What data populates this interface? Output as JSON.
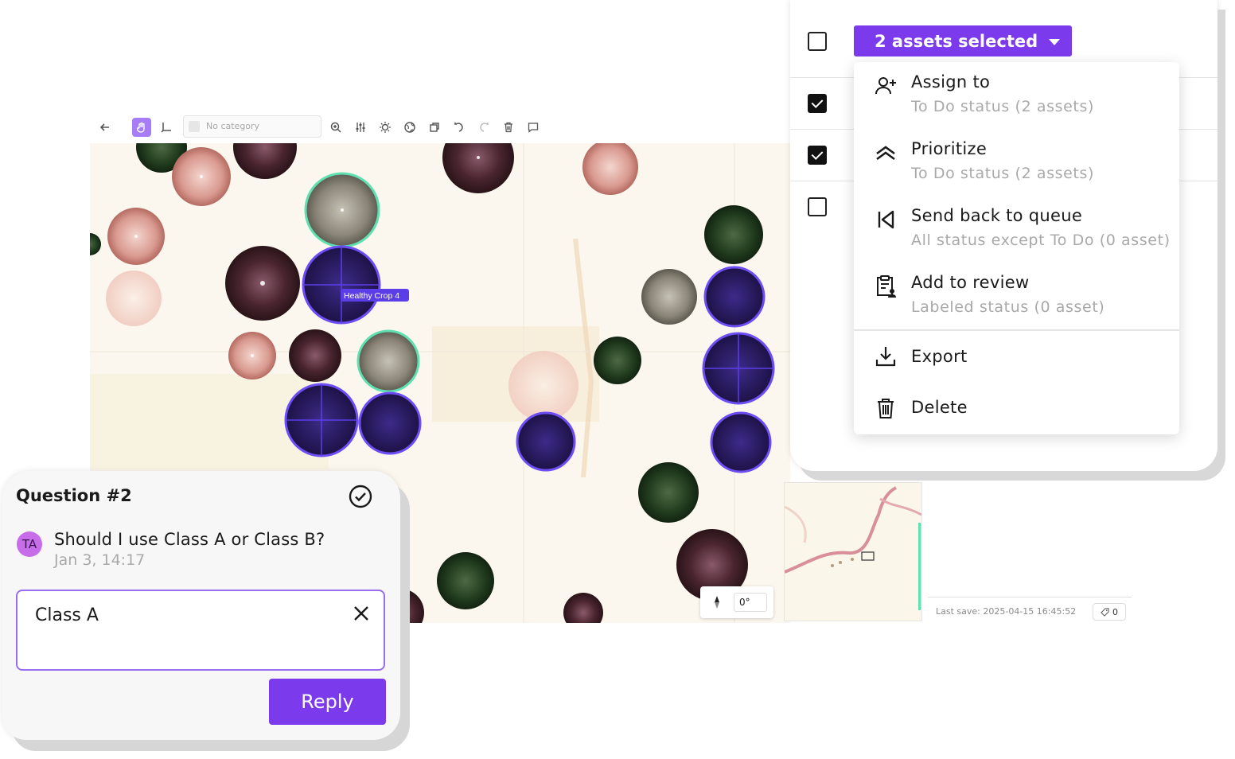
{
  "toolbar": {
    "category_placeholder": "No category",
    "icons": [
      "back-arrow-icon",
      "hand-icon",
      "bbox-tool-icon",
      "zoom-in-icon",
      "adjust-icon",
      "brightness-icon",
      "globe-icon",
      "crop-icon",
      "undo-icon",
      "redo-icon",
      "delete-icon",
      "comment-icon"
    ]
  },
  "canvas": {
    "annotation_label": "Healthy Crop 4"
  },
  "selection": {
    "button_label": "2 assets selected",
    "rows_checked": [
      false,
      true,
      true,
      false
    ]
  },
  "menu": {
    "items": [
      {
        "label": "Assign to",
        "sub": "To Do status (2 assets)",
        "icon": "user-plus-icon"
      },
      {
        "label": "Prioritize",
        "sub": "To Do status (2 assets)",
        "icon": "double-chevron-up-icon"
      },
      {
        "label": "Send back to queue",
        "sub": "All status except To Do (0 asset)",
        "icon": "skip-back-icon"
      },
      {
        "label": "Add to review",
        "sub": "Labeled status (0 asset)",
        "icon": "clipboard-user-icon"
      },
      {
        "label": "Export",
        "icon": "download-icon"
      },
      {
        "label": "Delete",
        "icon": "trash-icon"
      }
    ]
  },
  "status": {
    "last_save": "Last save: 2025-04-15 16:45:52",
    "tag_count": "0"
  },
  "rotation": {
    "value": "0°"
  },
  "question": {
    "title": "Question #2",
    "avatar_initials": "TA",
    "text": "Should I use Class A or Class B?",
    "time": "Jan 3, 14:17",
    "reply_value": "Class A",
    "reply_button": "Reply"
  },
  "colors": {
    "accent": "#7c3aed",
    "annotation_fill": "#2f1a8a",
    "annotation_stroke": "#6d4df5",
    "selected_stroke": "#5ee0b0"
  }
}
